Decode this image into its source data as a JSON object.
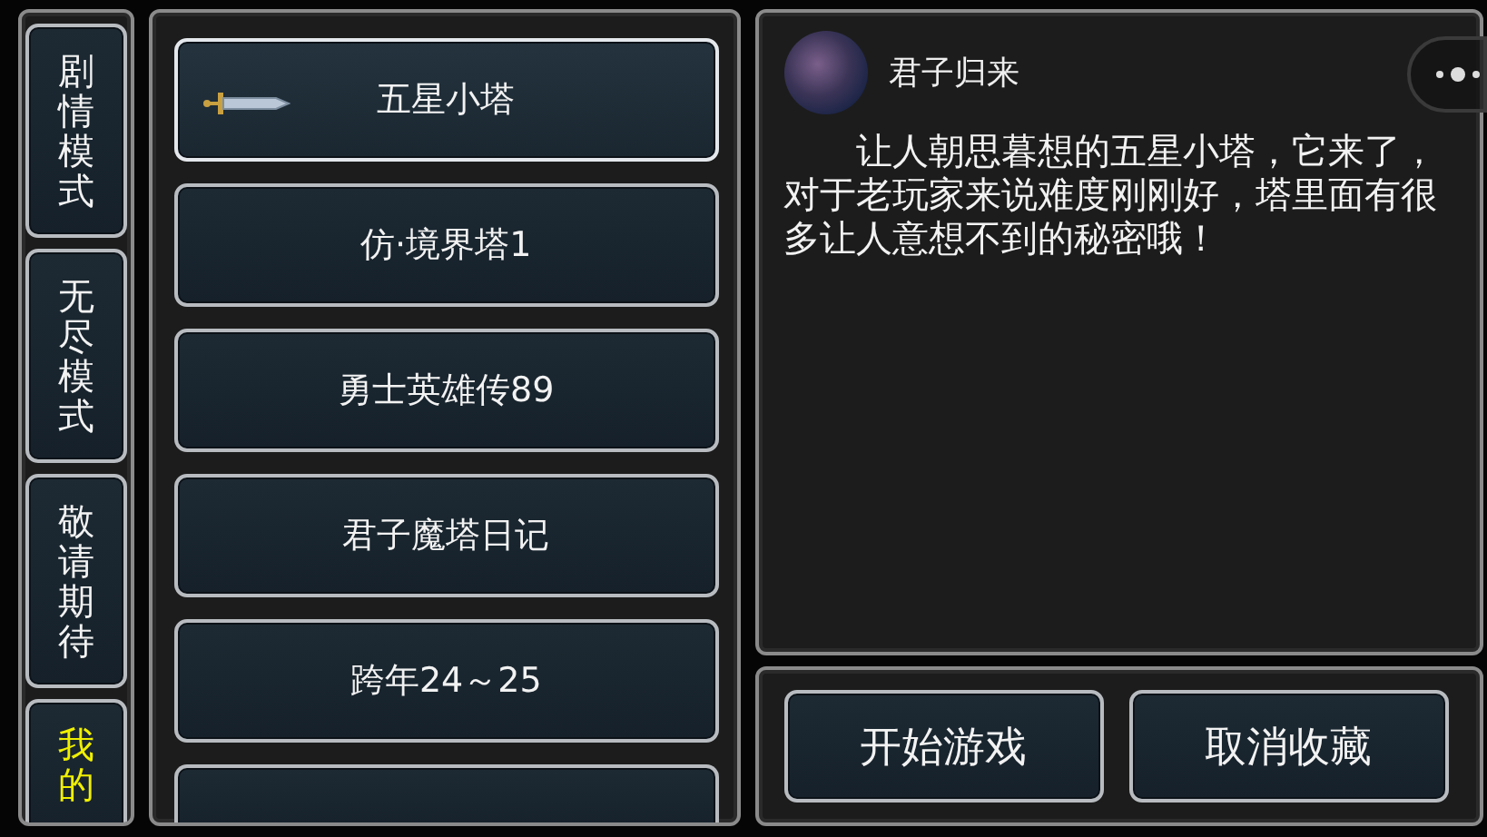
{
  "tabs": [
    {
      "label": "剧情模式",
      "selected": false
    },
    {
      "label": "无尽模式",
      "selected": false
    },
    {
      "label": "敬请期待",
      "selected": false
    },
    {
      "label": "我的",
      "selected": true
    }
  ],
  "games": [
    {
      "title": "五星小塔",
      "selected": true
    },
    {
      "title": "仿·境界塔1",
      "selected": false
    },
    {
      "title": "勇士英雄传89",
      "selected": false
    },
    {
      "title": "君子魔塔日记",
      "selected": false
    },
    {
      "title": "跨年24～25",
      "selected": false
    }
  ],
  "detail": {
    "author": "君子归来",
    "description": "让人朝思暮想的五星小塔，它来了，对于老玩家来说难度刚刚好，塔里面有很多让人意想不到的秘密哦！"
  },
  "buttons": [
    {
      "label": "开始游戏"
    },
    {
      "label": "取消收藏"
    }
  ]
}
